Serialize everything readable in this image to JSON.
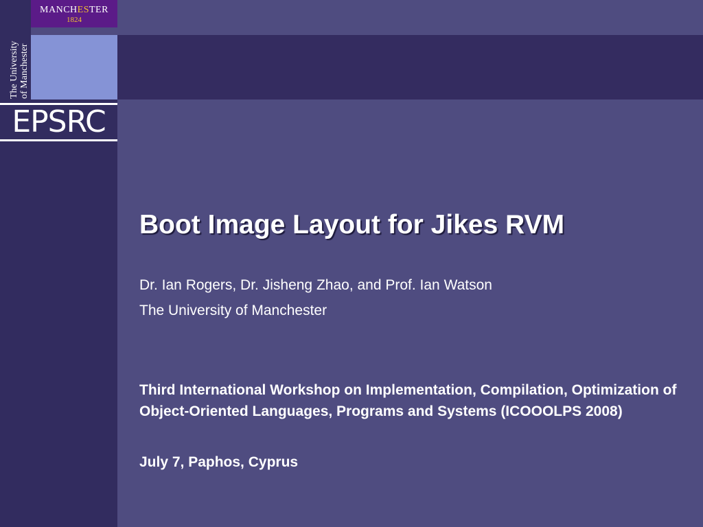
{
  "logos": {
    "manchester_name_pre": "MANCH",
    "manchester_name_es": "ES",
    "manchester_name_post": "TER",
    "manchester_year": "1824",
    "university_line1": "The University",
    "university_line2": "of Manchester",
    "epsrc": "EPSRC"
  },
  "slide": {
    "title": "Boot Image Layout for Jikes RVM",
    "authors": "Dr. Ian Rogers, Dr. Jisheng Zhao, and Prof. Ian Watson",
    "affiliation": "The University of Manchester",
    "workshop": "Third International Workshop on Implementation, Compilation, Optimization of Object-Oriented Languages, Programs and Systems (ICOOOLPS 2008)",
    "date_place": "July 7, Paphos, Cyprus"
  },
  "colors": {
    "background": "#4f4c80",
    "sidebar": "#322c5f",
    "top_band": "#342c60",
    "light_block": "#8593d6",
    "manchester_purple": "#5b1b88",
    "manchester_gold": "#f2c230",
    "text": "#ffffff"
  }
}
